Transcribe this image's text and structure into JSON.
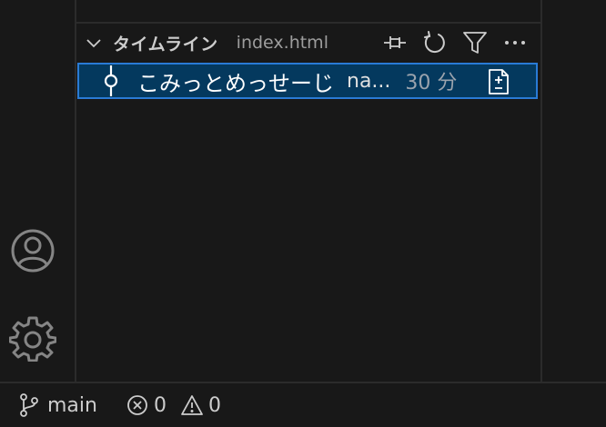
{
  "colors": {
    "background": "#181818",
    "selection": "#04395e",
    "focus_border": "#2a7bd5"
  },
  "timeline": {
    "title": "タイムライン",
    "file": "index.html",
    "actions": [
      {
        "icon": "pin-icon"
      },
      {
        "icon": "refresh-icon"
      },
      {
        "icon": "filter-icon"
      },
      {
        "icon": "more-icon"
      }
    ],
    "items": [
      {
        "message": "こみっとめっせーじ",
        "author": "na...",
        "time": "30 分",
        "icon": "git-commit-icon",
        "action_icon": "diff-file-icon"
      }
    ]
  },
  "activity_bar": {
    "items": [
      {
        "icon": "account-icon"
      },
      {
        "icon": "gear-icon"
      }
    ]
  },
  "status_bar": {
    "branch": "main",
    "errors": "0",
    "warnings": "0"
  }
}
